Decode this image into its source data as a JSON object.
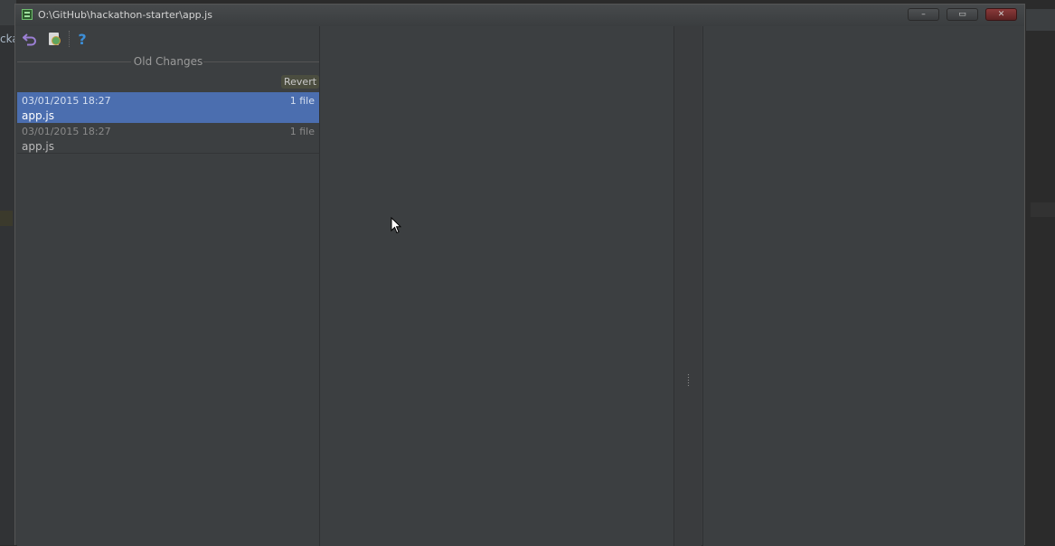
{
  "window": {
    "title": "O:\\GitHub\\hackathon-starter\\app.js",
    "buttons": {
      "minimize": "–",
      "maximize": "▭",
      "close": "✕"
    }
  },
  "background": {
    "left_text": "cka"
  },
  "toolbar": {
    "revert_icon": "undo-arrow-icon",
    "shelf_icon": "create-patch-icon",
    "help_label": "?"
  },
  "history": {
    "section_title": "Old Changes",
    "revert_label": "Revert",
    "revisions": [
      {
        "date": "03/01/2015 18:27",
        "count": "1 file",
        "file": "app.js",
        "selected": true
      },
      {
        "date": "03/01/2015 18:27",
        "count": "1 file",
        "file": "app.js",
        "selected": false
      }
    ]
  },
  "colors": {
    "selection": "#4b6eaf",
    "panel": "#3c3f41",
    "accent_revert_icon": "#9b7fd4",
    "accent_help_icon": "#3d8fd8"
  }
}
